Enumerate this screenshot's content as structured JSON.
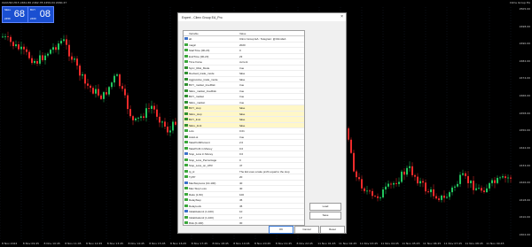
{
  "chart": {
    "symbol_caption": "XAUUSD,H15  2461.80 2462.78 2459.04 2460.47",
    "ea_caption": "Clims Group EA",
    "price_labels": [
      "2505.00",
      "2498.00",
      "2490.00",
      "2482.00",
      "2474.00",
      "2466.00",
      "2458.00",
      "2450.00",
      "2442.00",
      "2434.00",
      "2426.00",
      "2418.00",
      "2410.00",
      "2402.00"
    ],
    "time_labels": [
      "8 Nov 2024",
      "8 Nov 09:45",
      "8 Nov 10:45",
      "8 Nov 11:45",
      "8 Nov 12:45",
      "8 Nov 13:45",
      "8 Nov 14:45",
      "8 Nov 15:45",
      "8 Nov 16:45",
      "8 Nov 17:45",
      "8 Nov 18:45",
      "8 Nov 19:45",
      "8 Nov 20:45",
      "8 Nov 21:45",
      "8 Nov 22:45",
      "11 Nov 01:45",
      "11 Nov 02:45",
      "11 Nov 03:45",
      "11 Nov 04:45",
      "11 Nov 05:45",
      "11 Nov 06:45",
      "11 Nov 07:45",
      "11 Nov 08:45",
      "11 Nov 09:45"
    ],
    "colors": {
      "bull": "#22c55e",
      "bear": "#ef2b2b",
      "grid": "#202a40"
    }
  },
  "quote": {
    "sell": {
      "label": "SELL",
      "big": "68",
      "small": "2459"
    },
    "buy": {
      "label": "BUY",
      "big": "08",
      "small": "2460"
    },
    "lot": "1.00"
  },
  "dialog": {
    "title": "Expert - Climx Group EA_Pro",
    "close_glyph": "×",
    "tabs": [
      "Common",
      "Dependencies",
      "Inputs"
    ],
    "active_tab": 2,
    "columns": {
      "variable": "Variable",
      "value": "Value"
    },
    "rows": [
      {
        "name": "ab",
        "value": "Climx Group EA : Telegram: @ClimxEA"
      },
      {
        "name": "magic",
        "value": "2020"
      },
      {
        "name": "StartTime (00-23)",
        "value": "0"
      },
      {
        "name": "EndTime (00-23)",
        "value": "23"
      },
      {
        "name": "Time frame",
        "value": "current"
      },
      {
        "name": "Sync_Risk_Mode",
        "value": "true"
      },
      {
        "name": "Revised_trade_mode",
        "value": "false"
      },
      {
        "name": "Aggressive_trade_mode",
        "value": "false"
      },
      {
        "name": "BUY_market_trueRisk",
        "value": "true"
      },
      {
        "name": "SELL_market_trueRisk",
        "value": "true"
      },
      {
        "name": "BUY_market",
        "value": "true"
      },
      {
        "name": "SELL_market",
        "value": "true"
      },
      {
        "name": "BUY_stop",
        "value": "false"
      },
      {
        "name": "SELL_stop",
        "value": "false"
      },
      {
        "name": "BUY_limit",
        "value": "false"
      },
      {
        "name": "SELL_limit",
        "value": "false"
      },
      {
        "name": "Lots",
        "value": "0.01"
      },
      {
        "name": "AutoLot",
        "value": "true"
      },
      {
        "name": "TakeProfitPercent",
        "value": "2.0"
      },
      {
        "name": "TakeProfit in Money",
        "value": "0.0"
      },
      {
        "name": "Stop_Loss in Money",
        "value": "0.0"
      },
      {
        "name": "Stop_Loss_Percentage",
        "value": "0"
      },
      {
        "name": "Stop_Loss_on_ATR",
        "value": "47"
      },
      {
        "name": "tp_sl",
        "value": "The EA uses a take profit equal to the stop"
      },
      {
        "name": "TpTP",
        "value": "20"
      },
      {
        "name": "MaxStopLoss (10-100)",
        "value": "40"
      },
      {
        "name": "Max Stop Loss",
        "value": "40"
      },
      {
        "name": "Ratio (1-50)",
        "value": "100"
      },
      {
        "name": "DelayStep",
        "value": "45"
      },
      {
        "name": "DelayLock",
        "value": "45"
      },
      {
        "name": "Initialization1 (1-100)",
        "value": "10"
      },
      {
        "name": "Initialization2 (1-100)",
        "value": "17"
      },
      {
        "name": "Risk (0-100)",
        "value": "30"
      }
    ],
    "side_buttons": [
      "Load",
      "Save"
    ],
    "bottom_buttons": [
      "OK",
      "Cancel",
      "Reset"
    ]
  },
  "watermark": {
    "text": "comforex.com",
    "brand": "Com",
    "icon": "comforex-logo-icon"
  }
}
